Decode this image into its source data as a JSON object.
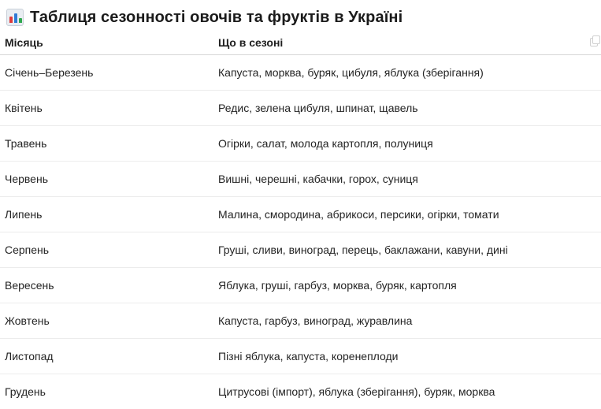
{
  "header": {
    "title": "Таблиця сезонності овочів та фруктів в Україні",
    "icon": "bar-chart-icon"
  },
  "table": {
    "columns": [
      "Місяць",
      "Що в сезоні"
    ],
    "rows": [
      {
        "month": "Січень–Березень",
        "produce": "Капуста, морква, буряк, цибуля, яблука (зберігання)"
      },
      {
        "month": "Квітень",
        "produce": "Редис, зелена цибуля, шпинат, щавель"
      },
      {
        "month": "Травень",
        "produce": "Огірки, салат, молода картопля, полуниця"
      },
      {
        "month": "Червень",
        "produce": "Вишні, черешні, кабачки, горох, суниця"
      },
      {
        "month": "Липень",
        "produce": "Малина, смородина, абрикоси, персики, огірки, томати"
      },
      {
        "month": "Серпень",
        "produce": "Груші, сливи, виноград, перець, баклажани, кавуни, дині"
      },
      {
        "month": "Вересень",
        "produce": "Яблука, груші, гарбуз, морква, буряк, картопля"
      },
      {
        "month": "Жовтень",
        "produce": "Капуста, гарбуз, виноград, журавлина"
      },
      {
        "month": "Листопад",
        "produce": "Пізні яблука, капуста, коренеплоди"
      },
      {
        "month": "Грудень",
        "produce": "Цитрусові (імпорт), яблука (зберігання), буряк, морква"
      }
    ],
    "copy_icon": "copy-icon"
  }
}
